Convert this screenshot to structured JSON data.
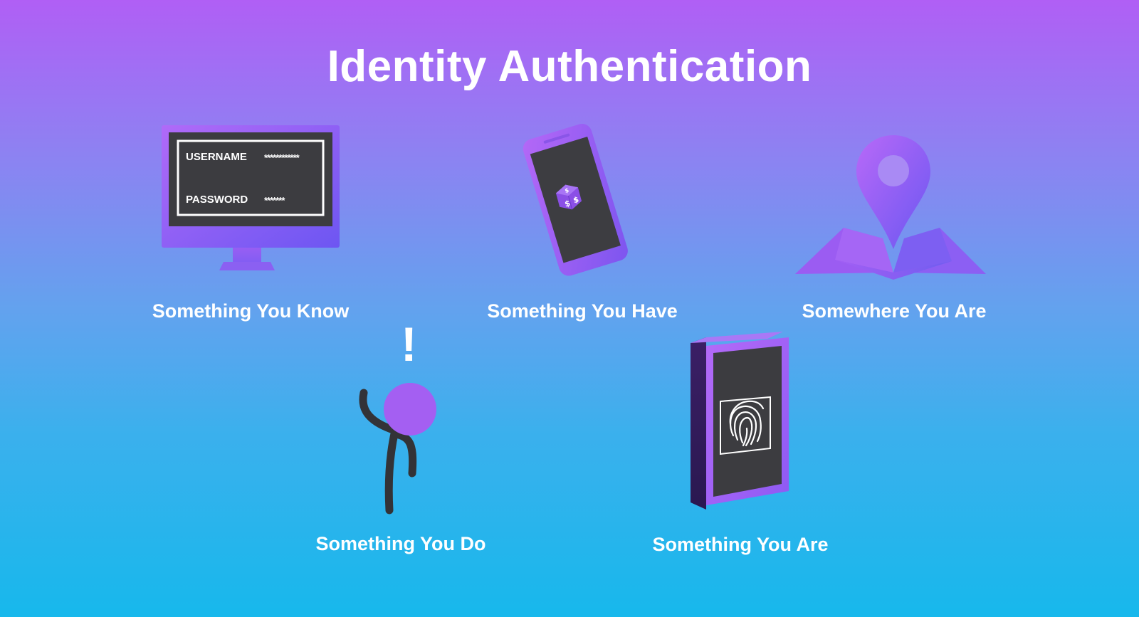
{
  "title": "Identity Authentication",
  "factors": [
    {
      "label": "Something You Know",
      "icon": "monitor-login-icon"
    },
    {
      "label": "Something You Have",
      "icon": "smartphone-icon"
    },
    {
      "label": "Somewhere You Are",
      "icon": "map-pin-icon"
    },
    {
      "label": "Something You Do",
      "icon": "stick-figure-waving-icon"
    },
    {
      "label": "Something You Are",
      "icon": "fingerprint-device-icon"
    }
  ],
  "login": {
    "username_label": "USERNAME",
    "username_value": "************",
    "password_label": "PASSWORD",
    "password_value": "*******"
  },
  "exclamation": "!",
  "colors": {
    "purple": "#a66cf7",
    "violet": "#7a57f0",
    "dark_screen": "#3d3d41",
    "figure_body": "#333337"
  }
}
